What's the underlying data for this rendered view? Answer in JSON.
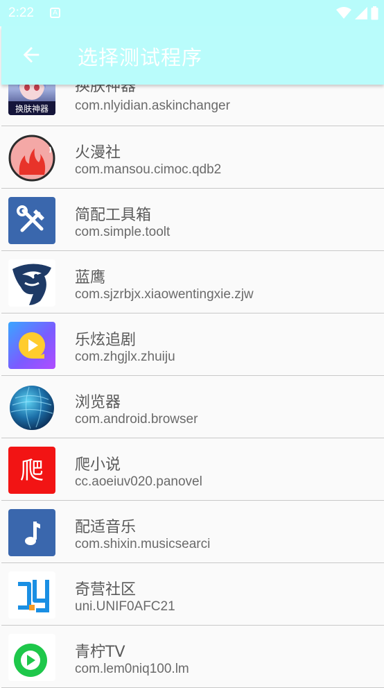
{
  "status_bar": {
    "time": "2:22",
    "notification_glyph": "A"
  },
  "app_bar": {
    "title": "选择测试程序",
    "back_icon": "arrow-left-icon"
  },
  "apps": [
    {
      "name": "换肤神器",
      "package": "com.nlyidian.askinchanger",
      "icon_label": "换肤神器",
      "icon": "anime-character-icon"
    },
    {
      "name": "火漫社",
      "package": "com.mansou.cimoc.qdb2",
      "icon": "flame-icon"
    },
    {
      "name": "简配工具箱",
      "package": "com.simple.toolt",
      "icon": "tools-icon"
    },
    {
      "name": "蓝鹰",
      "package": "com.sjzrbjx.xiaowentingxie.zjw",
      "icon": "eagle-icon"
    },
    {
      "name": "乐炫追剧",
      "package": "com.zhgjlx.zhuiju",
      "icon": "play-icon"
    },
    {
      "name": "浏览器",
      "package": "com.android.browser",
      "icon": "globe-icon"
    },
    {
      "name": "爬小说",
      "package": "cc.aoeiuv020.panovel",
      "icon_label": "爬",
      "icon": "pa-character-icon"
    },
    {
      "name": "配适音乐",
      "package": "com.shixin.musicsearci",
      "icon": "music-note-icon"
    },
    {
      "name": "奇营社区",
      "package": "uni.UNIF0AFC21",
      "icon": "qi-logo-icon"
    },
    {
      "name": "青柠TV",
      "package": "com.lem0niq100.lm",
      "icon": "play-circle-icon"
    }
  ],
  "colors": {
    "app_bar": "#b9fcfb",
    "divider": "#c8c8c8",
    "text": "#5a5a5a"
  }
}
